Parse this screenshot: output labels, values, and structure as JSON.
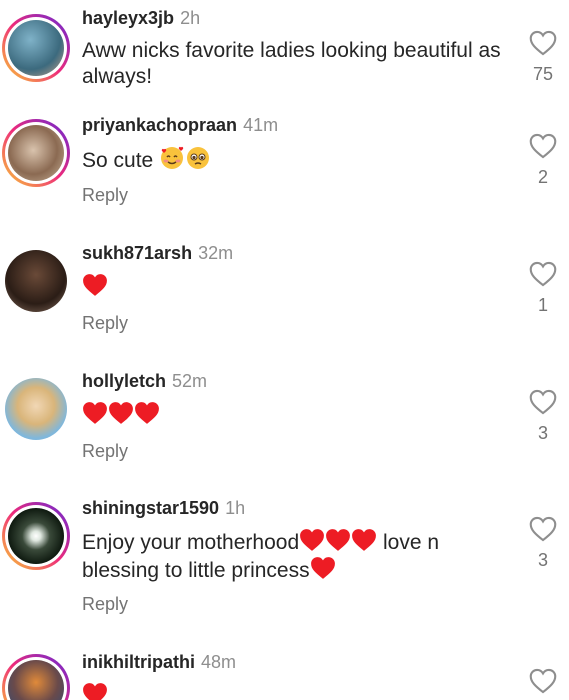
{
  "reply_label": "Reply",
  "colors": {
    "ring_gradient": [
      "#f9ce34",
      "#ee2a7b",
      "#6228d7"
    ],
    "heart_red": "#ed1c24",
    "meta_gray": "#8e8e8e"
  },
  "comments": [
    {
      "username": "hayleyx3jb",
      "time": "2h",
      "text": "Aww nicks favorite ladies looking beautiful as always!",
      "likes": "75",
      "has_story_ring": true,
      "show_reply": false
    },
    {
      "username": "priyankachopraan",
      "time": "41m",
      "text": "So cute ",
      "emojis": [
        "smiling-face-with-hearts",
        "pleading-face"
      ],
      "likes": "2",
      "has_story_ring": true,
      "show_reply": true
    },
    {
      "username": "sukh871arsh",
      "time": "32m",
      "text": "",
      "emojis": [
        "red-heart"
      ],
      "likes": "1",
      "has_story_ring": false,
      "show_reply": true
    },
    {
      "username": "hollyletch",
      "time": "52m",
      "text": "",
      "emojis": [
        "red-heart",
        "red-heart",
        "red-heart"
      ],
      "likes": "3",
      "has_story_ring": false,
      "show_reply": true
    },
    {
      "username": "shiningstar1590",
      "time": "1h",
      "text_part1": "Enjoy your motherhood",
      "text_part2": " love n blessing to little princess",
      "likes": "3",
      "has_story_ring": true,
      "show_reply": true
    },
    {
      "username": "inikhiltripathi",
      "time": "48m",
      "text": "",
      "emojis": [
        "red-heart"
      ],
      "likes": "",
      "has_story_ring": true,
      "show_reply": false
    }
  ]
}
